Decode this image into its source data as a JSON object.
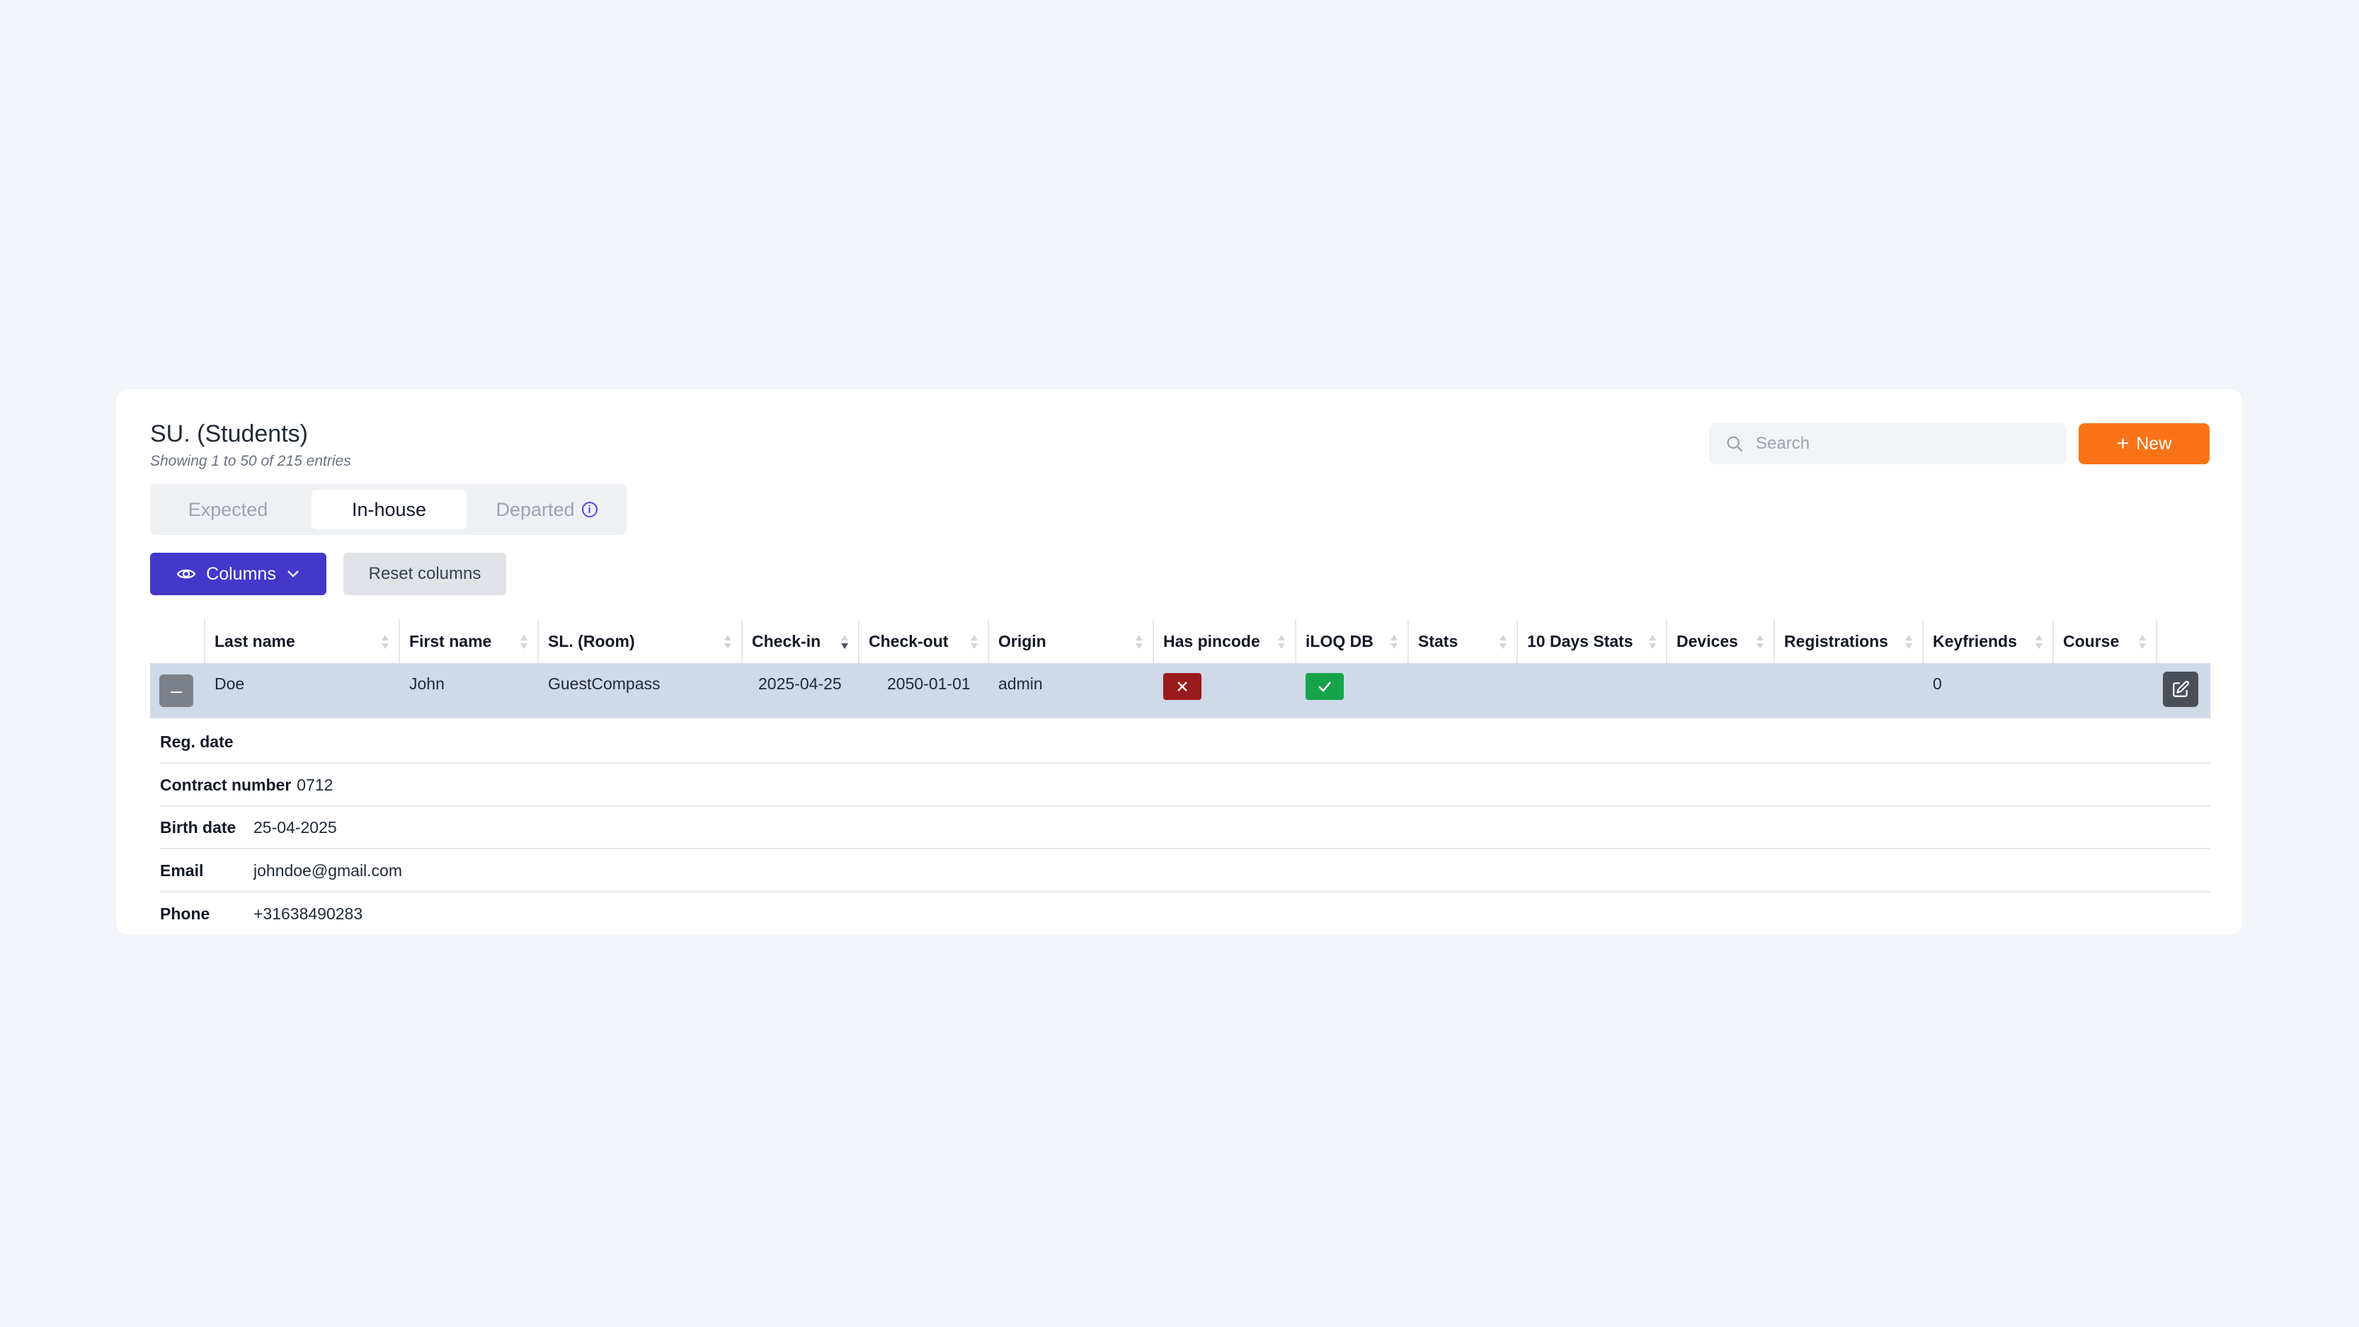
{
  "page": {
    "title": "SU. (Students)",
    "subtitle": "Showing 1 to 50 of 215 entries"
  },
  "search": {
    "placeholder": "Search",
    "value": ""
  },
  "actions": {
    "new_label": "New"
  },
  "tabs": [
    {
      "label": "Expected",
      "active": false
    },
    {
      "label": "In-house",
      "active": true
    },
    {
      "label": "Departed",
      "active": false,
      "has_info_icon": true
    }
  ],
  "toolbar": {
    "columns_label": "Columns",
    "reset_label": "Reset columns"
  },
  "table": {
    "columns": [
      "Last name",
      "First name",
      "SL. (Room)",
      "Check-in",
      "Check-out",
      "Origin",
      "Has pincode",
      "iLOQ DB",
      "Stats",
      "10 Days Stats",
      "Devices",
      "Registrations",
      "Keyfriends",
      "Course"
    ],
    "sorted_column": "Check-in",
    "sort_direction": "descending",
    "rows": [
      {
        "expanded": true,
        "expand_symbol": "–",
        "last_name": "Doe",
        "first_name": "John",
        "room": "GuestCompass",
        "check_in": "2025-04-25",
        "check_out": "2050-01-01",
        "origin": "admin",
        "has_pincode": false,
        "has_pincode_icon": "x-icon",
        "iloq_db": true,
        "iloq_db_icon": "check-icon",
        "stats": "",
        "ten_days_stats": "",
        "devices": "",
        "registrations": "",
        "keyfriends": "0",
        "course": ""
      }
    ]
  },
  "details": {
    "reg_date": {
      "label": "Reg. date",
      "value": ""
    },
    "contract_number": {
      "label": "Contract number",
      "value": "0712"
    },
    "birth_date": {
      "label": "Birth date",
      "value": "25-04-2025"
    },
    "email": {
      "label": "Email",
      "value": "johndoe@gmail.com"
    },
    "phone": {
      "label": "Phone",
      "value": "+31638490283"
    }
  },
  "colors": {
    "background": "#f1f5f9",
    "primary": "#4338ca",
    "accent": "#f97316",
    "danger": "#991b1b",
    "success": "#16a34a",
    "row_highlight": "#cfd9e8"
  }
}
